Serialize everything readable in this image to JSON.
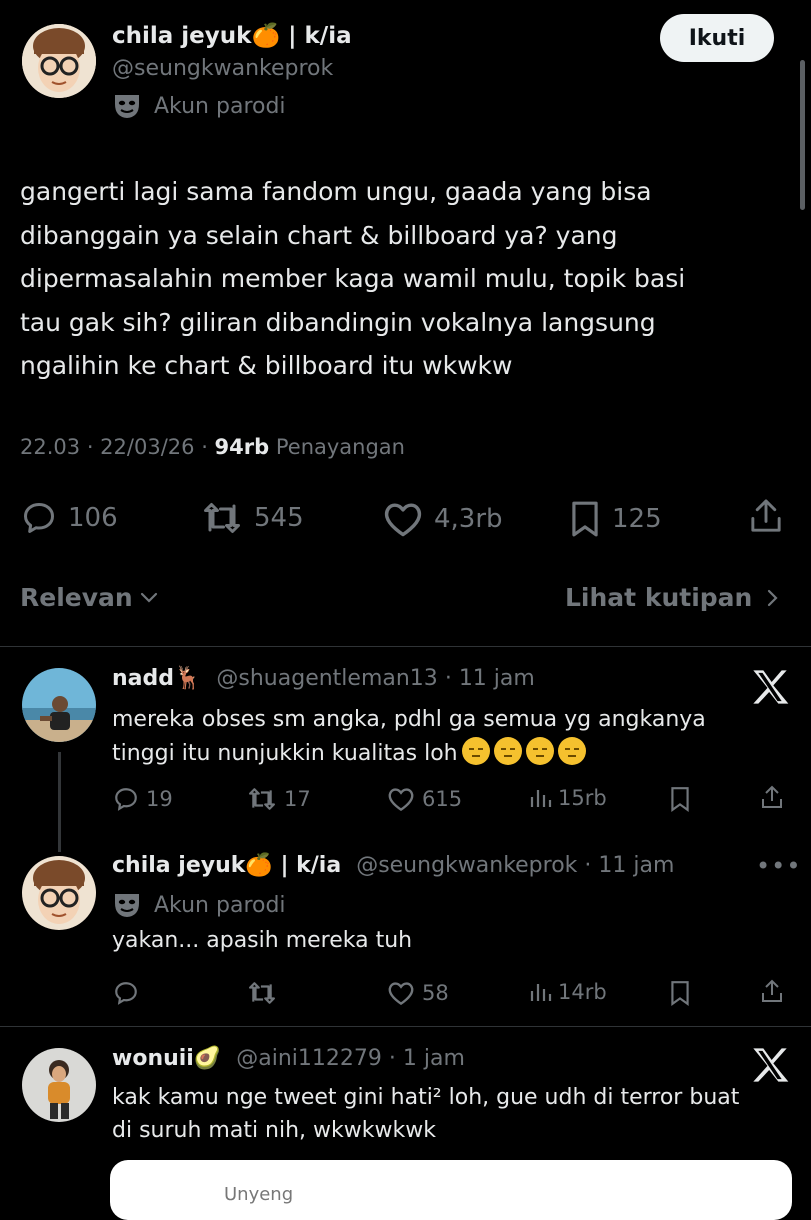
{
  "colors": {
    "background": "#000000",
    "text": "#e7e9ea",
    "muted": "#71767b",
    "divider": "#2f3336",
    "button_bg": "#eff3f4"
  },
  "main_tweet": {
    "display_name": "chila jeyuk🍊 | k/ia",
    "handle": "@seungkwankeprok",
    "parody_label": "Akun parodi",
    "follow_label": "Ikuti",
    "text_lines": [
      "gangerti lagi sama fandom ungu, gaada yang bisa",
      "dibanggain ya selain chart & billboard ya? yang",
      "dipermasalahin member kaga wamil mulu, topik basi",
      "tau gak sih? giliran dibandingin vokalnya langsung",
      "ngalihin ke chart & billboard itu wkwkw"
    ],
    "time": "22.03",
    "date": "22/03/26",
    "views_count": "94rb",
    "views_label": "Penayangan",
    "replies": "106",
    "reposts": "545",
    "likes": "4,3rb",
    "bookmarks": "125"
  },
  "filter": {
    "sort_label": "Relevan",
    "quotes_label": "Lihat kutipan"
  },
  "replies": [
    {
      "display_name": "nadd🦌",
      "handle": "@shuagentleman13",
      "time": "11 jam",
      "text_line1": "mereka obses sm angka, pdhl ga semua yg angkanya",
      "text_line2": "tinggi itu nunjukkin kualitas loh",
      "replies": "19",
      "reposts": "17",
      "likes": "615",
      "views": "15rb"
    },
    {
      "display_name": "chila jeyuk🍊 | k/ia",
      "handle": "@seungkwankeprok",
      "time": "11 jam",
      "parody_label": "Akun parodi",
      "text": "yakan... apasih mereka tuh",
      "replies": "",
      "reposts": "",
      "likes": "58",
      "views": "14rb"
    },
    {
      "display_name": "wonuii🥑",
      "handle": "@aini112279",
      "time": "1 jam",
      "text_line1": "kak kamu nge tweet gini hati² loh, gue udh di terror buat",
      "text_line2": "di suruh mati nih, wkwkwkwk",
      "partial_card": "Unyeng"
    }
  ],
  "icons": [
    "reply-icon",
    "repost-icon",
    "like-icon",
    "bookmark-icon",
    "share-icon",
    "views-icon",
    "mask-icon",
    "x-logo-icon",
    "more-icon",
    "chevron-down-icon",
    "chevron-right-icon"
  ]
}
